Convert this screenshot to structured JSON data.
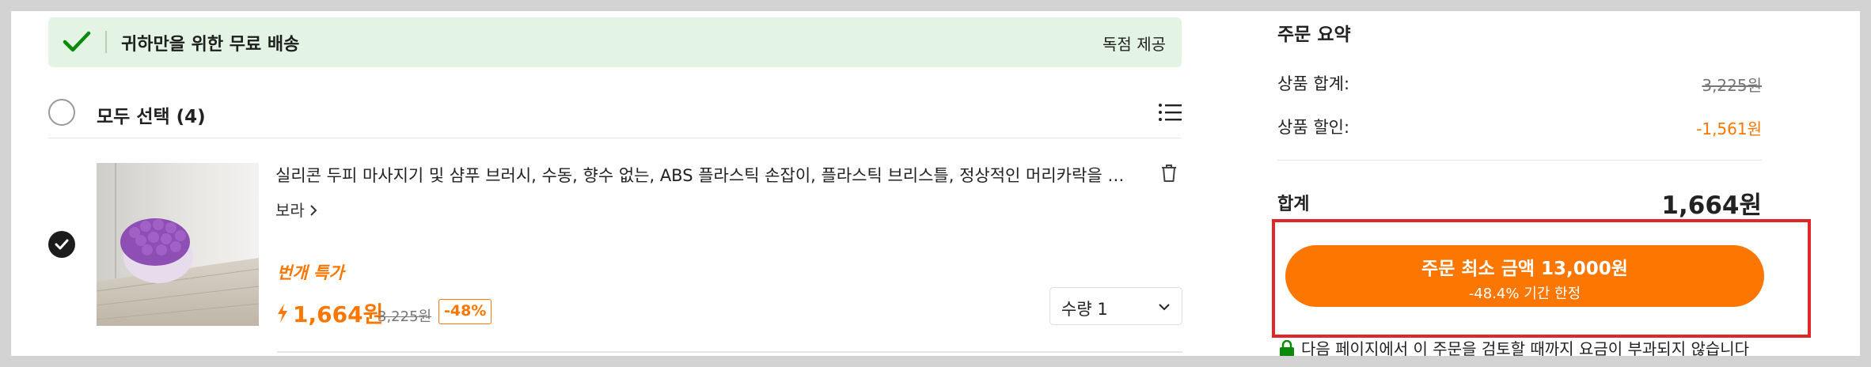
{
  "banner": {
    "text": "귀하만을 위한 무료 배송",
    "right_text": "독점 제공",
    "accent": "#0a8a0a"
  },
  "select_all": {
    "label": "모두 선택 (4)"
  },
  "item": {
    "title": "실리콘 두피 마사지기 및 샴푸 브러시, 수동, 향수 없는, ABS 플라스틱 손잡이, 플라스틱 브리스틀, 정상적인 머리카락을 위...",
    "see_more": "보라",
    "flash_label": "번개 특가",
    "price": "1,664원",
    "original_price": "3,225원",
    "discount": "-48%",
    "quantity_label": "수량 1",
    "image_icon": "scalp-massager-image"
  },
  "summary": {
    "title": "주문 요약",
    "subtotal_label": "상품 합계:",
    "subtotal_value": "3,225원",
    "discount_label": "상품 할인:",
    "discount_value": "-1,561원",
    "total_label": "합계",
    "total_value": "1,664원",
    "checkout_main": "주문 최소 금액 13,000원",
    "checkout_sub": "-48.4% 기간 한정",
    "notice": "다음 페이지에서 이 주문을 검토할 때까지 요금이 부과되지 않습니다"
  },
  "colors": {
    "brand_orange": "#fb7701",
    "highlight_red": "#e3262b",
    "banner_bg": "#e4f4e4"
  }
}
